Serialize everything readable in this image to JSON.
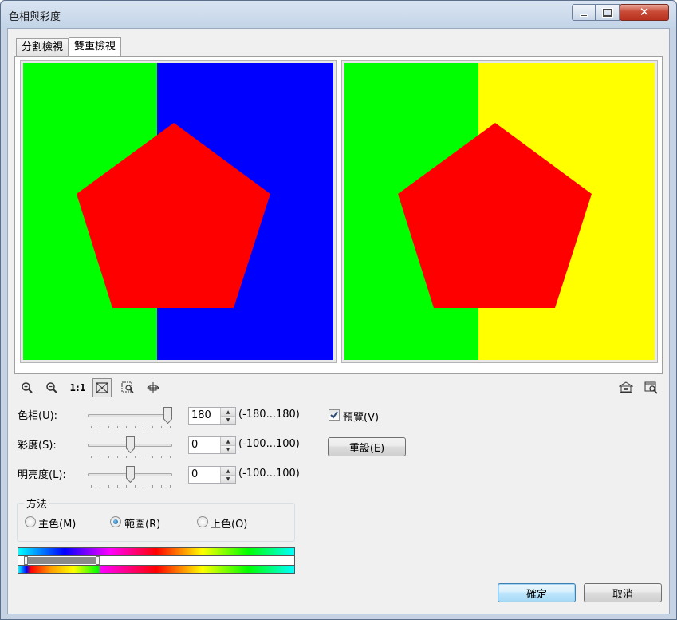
{
  "window": {
    "title": "色相與彩度"
  },
  "tabs": [
    {
      "label": "分割檢視",
      "active": false
    },
    {
      "label": "雙重檢視",
      "active": true
    }
  ],
  "preview": {
    "before": {
      "left_color": "#00ff00",
      "right_color": "#0000ff",
      "shape_color": "#ff0000",
      "shape": "pentagon"
    },
    "after": {
      "left_color": "#00ff00",
      "right_color": "#ffff00",
      "shape_color": "#ff0000",
      "shape": "pentagon"
    }
  },
  "toolbar": {
    "zoom_in_icon": "zoom-in-icon",
    "zoom_out_icon": "zoom-out-icon",
    "actual_size_label": "1:1",
    "fit_icon": "fit-window-icon",
    "zoom_region_icon": "zoom-region-icon",
    "pan_icon": "pan-icon",
    "right_icons": [
      "load-preset-icon",
      "preview-window-icon"
    ]
  },
  "adjustments": {
    "hue": {
      "label": "色相(U):",
      "value": "180",
      "range": "(-180...180)",
      "level": 1.0
    },
    "saturation": {
      "label": "彩度(S):",
      "value": "0",
      "range": "(-100...100)",
      "level": 0.5
    },
    "lightness": {
      "label": "明亮度(L):",
      "value": "0",
      "range": "(-100...100)",
      "level": 0.5
    }
  },
  "preview_checkbox": {
    "label": "預覽(V)",
    "checked": true
  },
  "reset_button": "重設(E)",
  "method": {
    "title": "方法",
    "options": [
      {
        "label": "主色(M)",
        "checked": false
      },
      {
        "label": "範圍(R)",
        "checked": true
      },
      {
        "label": "上色(O)",
        "checked": false
      }
    ]
  },
  "buttons": {
    "ok": "確定",
    "cancel": "取消"
  }
}
